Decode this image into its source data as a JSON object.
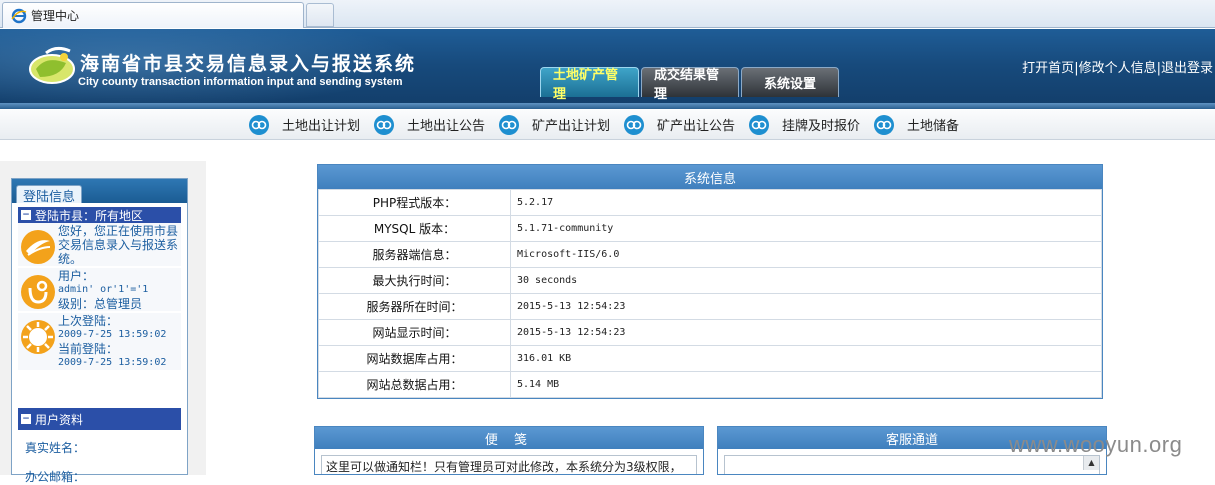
{
  "browser": {
    "tab_title": "管理中心"
  },
  "header": {
    "title": "海南省市县交易信息录入与报送系统",
    "subtitle": "City county transaction information input and sending system",
    "links": [
      "打开首页",
      "修改个人信息",
      "退出登录"
    ],
    "separator": "|"
  },
  "nav": {
    "tabs": [
      {
        "label": "土地矿产管理",
        "active": true
      },
      {
        "label": "成交结果管理",
        "active": false
      },
      {
        "label": "系统设置",
        "active": false
      }
    ]
  },
  "subnav": {
    "items": [
      "土地出让计划",
      "土地出让公告",
      "矿产出让计划",
      "矿产出让公告",
      "挂牌及时报价",
      "土地储备"
    ]
  },
  "sidebar": {
    "tab_label": "登陆信息",
    "region_bar": "登陆市县：所有地区",
    "welcome": "您好，您正在使用市县交易信息录入与报送系统。",
    "user_label": "用户：",
    "user_value": "admin' or'1'='1",
    "level": "级别：总管理员",
    "last_login_label": "上次登陆：",
    "last_login": "2009-7-25 13:59:02",
    "current_login_label": "当前登陆：",
    "current_login": "2009-7-25 13:59:02",
    "profile_bar": "用户资料",
    "real_name_label": "真实姓名：",
    "next_field_label": "办公邮箱："
  },
  "system_info": {
    "title": "系统信息",
    "rows": [
      {
        "key": "PHP程式版本：",
        "value": "5.2.17"
      },
      {
        "key": "MYSQL 版本：",
        "value": "5.1.71-community"
      },
      {
        "key": "服务器端信息：",
        "value": "Microsoft-IIS/6.0"
      },
      {
        "key": "最大执行时间：",
        "value": "30 seconds"
      },
      {
        "key": "服务器所在时间：",
        "value": "2015-5-13 12:54:23"
      },
      {
        "key": "网站显示时间：",
        "value": "2015-5-13 12:54:23"
      },
      {
        "key": "网站数据库占用：",
        "value": "316.01 KB"
      },
      {
        "key": "网站总数据占用：",
        "value": "5.14 MB"
      }
    ]
  },
  "notes": {
    "title": "便 笺",
    "text": "这里可以做通知栏！只有管理员可对此修改，本系统分为3级权限，"
  },
  "service": {
    "title": "客服通道"
  },
  "watermark": "www.wooyun.org",
  "colors": {
    "banner": "#174a7c",
    "active_tab_text": "#ffff66",
    "table_header": "#4a86c0"
  }
}
